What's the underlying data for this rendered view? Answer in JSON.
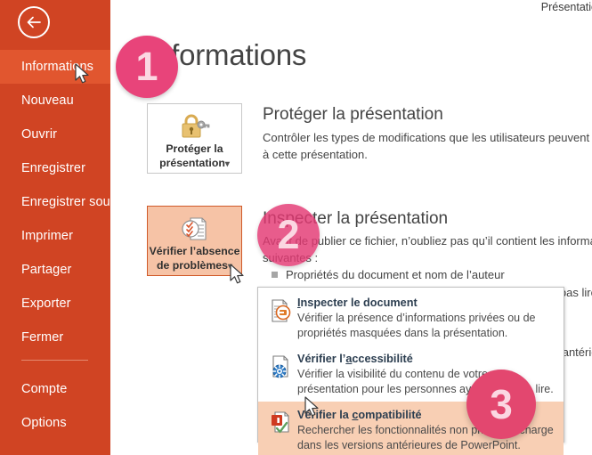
{
  "window": {
    "document_title": "Présentatio"
  },
  "sidebar": {
    "back_icon": "back-arrow-icon",
    "items": [
      {
        "label": "Informations",
        "active": true
      },
      {
        "label": "Nouveau",
        "active": false
      },
      {
        "label": "Ouvrir",
        "active": false
      },
      {
        "label": "Enregistrer",
        "active": false
      },
      {
        "label": "Enregistrer sous",
        "active": false
      },
      {
        "label": "Imprimer",
        "active": false
      },
      {
        "label": "Partager",
        "active": false
      },
      {
        "label": "Exporter",
        "active": false
      },
      {
        "label": "Fermer",
        "active": false
      }
    ],
    "bottom_items": [
      {
        "label": "Compte",
        "active": false
      },
      {
        "label": "Options",
        "active": false
      }
    ]
  },
  "main": {
    "heading": "Informations",
    "protect": {
      "tile_icon": "lock-key-icon",
      "tile_label_line1": "Protéger la",
      "tile_label_line2": "présentation",
      "tile_dropdown_arrow": "▾",
      "title": "Protéger la présentation",
      "body": "Contrôler les types de modifications que les utilisateurs peuvent apporter à cette présentation."
    },
    "inspect": {
      "tile_icon": "document-check-icon",
      "tile_label_line1": "Vérifier l’absence",
      "tile_label_line2": "de problèmes",
      "tile_dropdown_arrow": "▾",
      "title": "Inspecter la présentation",
      "body": "Avant de publier ce fichier, n’oubliez pas qu’il contient les informations suivantes :",
      "bullets": [
        "Propriétés du document et nom de l’auteur",
        "Contenu que les personnes handicapées ne peuvent pas lire",
        "Fonctionnalités non prises en charge par les versions antérieures de ce fichier."
      ]
    }
  },
  "dropdown": {
    "items": [
      {
        "icon": "inspect-document-icon",
        "title_pre": "",
        "title_accel": "I",
        "title_post": "nspecter le document",
        "desc_line1": "Vérifier la présence d’informations privées ou de",
        "desc_line2": "propriétés masquées dans la présentation.",
        "highlighted": false
      },
      {
        "icon": "accessibility-icon",
        "title_pre": "Vérifier l’",
        "title_accel": "a",
        "title_post": "ccessibilité",
        "desc_line1": "Vérifier la visibilité du contenu de votre",
        "desc_line2": "présentation pour les personnes ayant du mal à lire.",
        "highlighted": false
      },
      {
        "icon": "compatibility-check-icon",
        "title_pre": "Vérifier la ",
        "title_accel": "c",
        "title_post": "ompatibilité",
        "desc_line1": "Rechercher les fonctionnalités non prises en charge",
        "desc_line2": "dans les versions antérieures de PowerPoint.",
        "highlighted": true
      }
    ]
  },
  "callouts": [
    {
      "number": "1"
    },
    {
      "number": "2"
    },
    {
      "number": "3"
    }
  ],
  "colors": {
    "sidebar_bg": "#d04423",
    "sidebar_active": "#e1562f",
    "badge_pink": "#e8447a",
    "highlight_peach": "#f6c3a6"
  }
}
